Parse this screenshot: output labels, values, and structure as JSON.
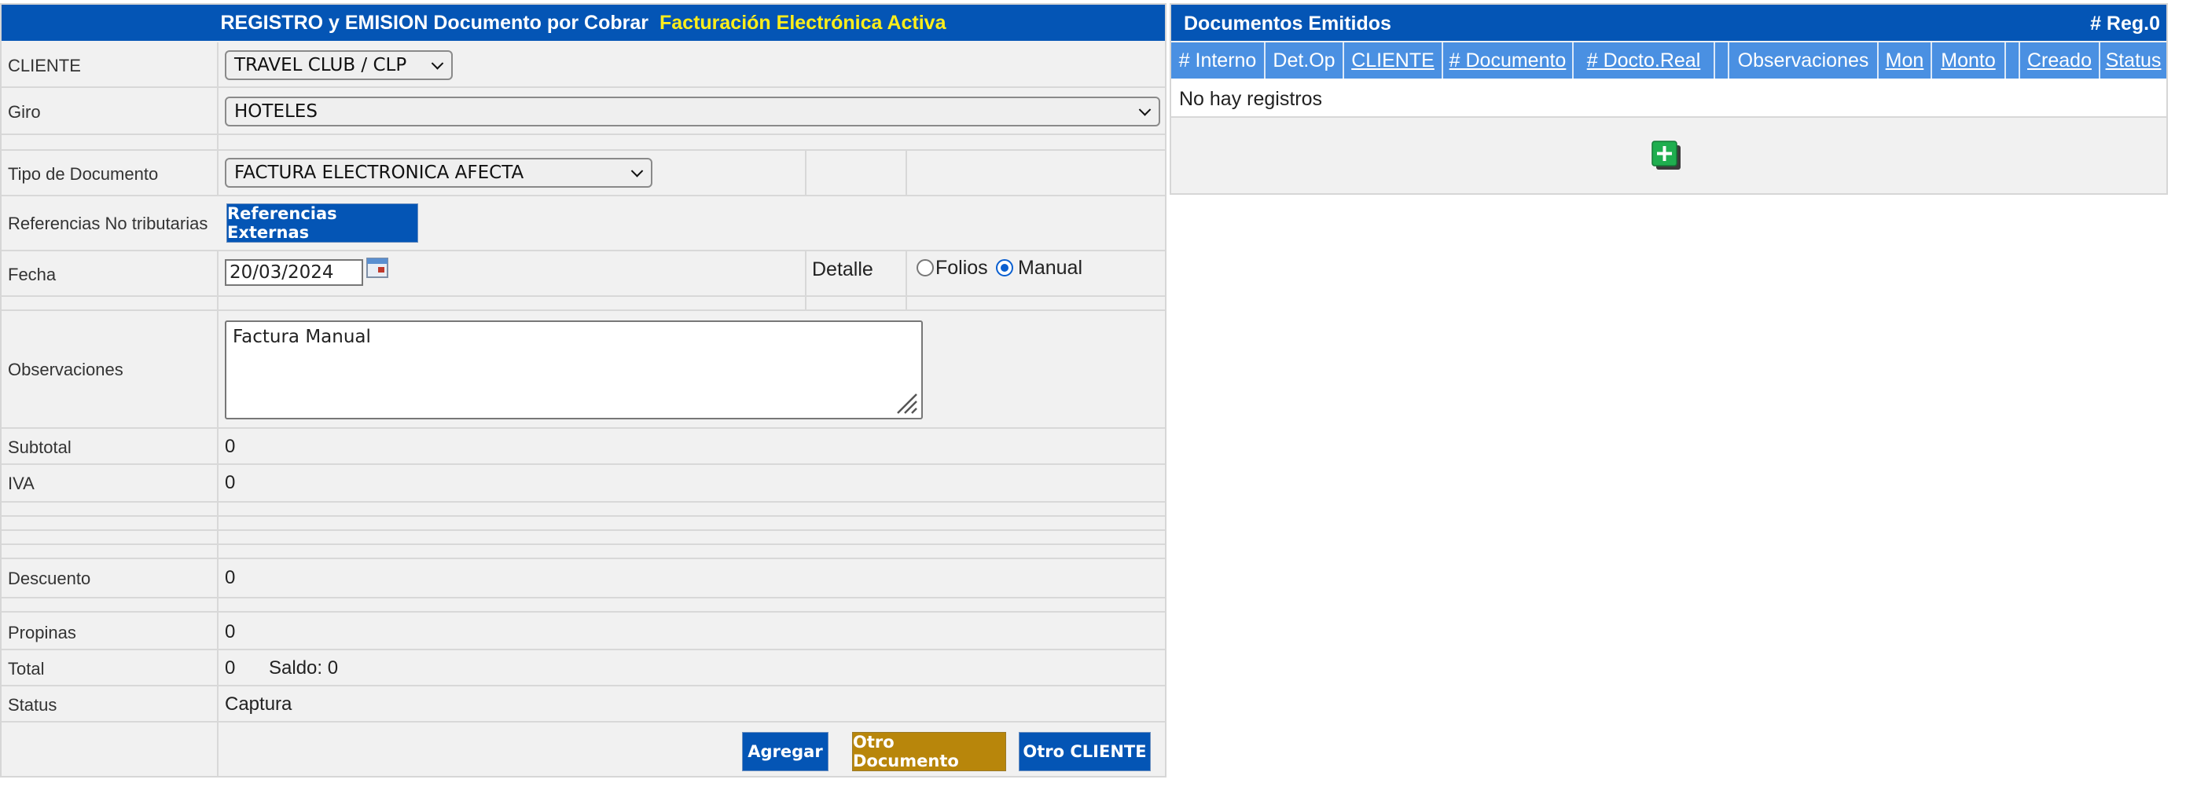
{
  "left_panel": {
    "title": "REGISTRO y EMISION Documento por Cobrar",
    "title_highlight": "Facturación Electrónica Activa",
    "cliente": {
      "label": "CLIENTE",
      "value": "TRAVEL CLUB / CLP"
    },
    "giro": {
      "label": "Giro",
      "value": "HOTELES"
    },
    "tipo_documento": {
      "label": "Tipo de Documento",
      "value": "FACTURA ELECTRONICA AFECTA"
    },
    "referencias": {
      "label": "Referencias No tributarias",
      "button_label": "Referencias Externas"
    },
    "fecha": {
      "label": "Fecha",
      "value": "20/03/2024"
    },
    "detalle": {
      "label": "Detalle",
      "option_folios": "Folios",
      "option_manual": "Manual",
      "selected": "Manual"
    },
    "observaciones": {
      "label": "Observaciones",
      "value": "Factura Manual"
    },
    "subtotal": {
      "label": "Subtotal",
      "value": "0"
    },
    "iva": {
      "label": "IVA",
      "value": "0"
    },
    "descuento": {
      "label": "Descuento",
      "value": "0"
    },
    "propinas": {
      "label": "Propinas",
      "value": "0"
    },
    "total": {
      "label": "Total",
      "value": "0",
      "saldo": "Saldo: 0"
    },
    "status": {
      "label": "Status",
      "value": "Captura"
    },
    "buttons": {
      "agregar": "Agregar",
      "otro_documento": "Otro Documento",
      "otro_cliente": "Otro CLIENTE"
    }
  },
  "right_panel": {
    "title": "Documentos Emitidos",
    "count": "# Reg.0",
    "columns": [
      "# Interno",
      "Det.Op",
      "CLIENTE",
      "# Documento",
      "# Docto.Real",
      "",
      "Observaciones",
      "Mon",
      "Monto",
      "",
      "Creado",
      "Status"
    ],
    "empty_message": "No hay registros",
    "add_icon": "add-plus-icon"
  },
  "colors": {
    "header_blue": "#0455b5",
    "highlight_yellow": "#ffee1a",
    "column_header_blue": "#4a90e2",
    "button_gold": "#b8860b",
    "add_green": "#1fae4f"
  }
}
